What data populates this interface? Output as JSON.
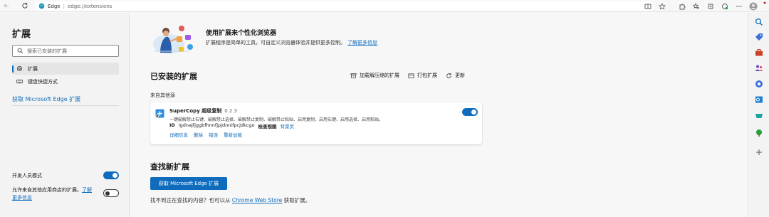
{
  "browser": {
    "edge_chip": "Edge",
    "address_sep": "|",
    "url": "edge://extensions"
  },
  "sidebar": {
    "title": "扩展",
    "search_placeholder": "搜索已安装的扩展",
    "items": [
      {
        "label": "扩展",
        "icon": "gear-icon",
        "active": true
      },
      {
        "label": "键盘快捷方式",
        "icon": "keyboard-icon",
        "active": false
      }
    ],
    "get_link": "获取 Microsoft Edge 扩展",
    "developer_mode": {
      "label": "开发人员模式",
      "on": true
    },
    "allow_other_stores": {
      "text": "允许来自其他应用商店的扩展。",
      "link": "了解更多信息",
      "on": false
    }
  },
  "hero": {
    "title": "使用扩展来个性化浏览器",
    "description": "扩展程序是简单的工具，可自定义浏览器体验并提供更多控制。",
    "link": "了解更多信息"
  },
  "installed": {
    "title": "已安装的扩展",
    "actions": [
      {
        "label": "加载解压缩的扩展",
        "icon": "load-unpacked-icon"
      },
      {
        "label": "打包扩展",
        "icon": "pack-icon"
      },
      {
        "label": "更新",
        "icon": "refresh-icon"
      }
    ],
    "group_label": "来自其他源"
  },
  "extension": {
    "name": "SuperCopy 超级复制",
    "version": "0.2.3",
    "description": "一键破解禁止右键、破解禁止选择、破解禁止复制、破解禁止粘贴、启用复制、启用右键、启用选择、启用粘贴。",
    "id_label": "ID",
    "id_value": "igdnajfjggbfhnnfjpjdnnifpcjdkcgo",
    "inspect_label": "检查视图",
    "background_page": "背景页",
    "links": [
      "详细信息",
      "删除",
      "错误",
      "重新加载"
    ],
    "enabled": true
  },
  "find": {
    "title": "查找新扩展",
    "button": "获取 Microsoft Edge 扩展",
    "text_before": "找不到正在查找的内容？也可以从",
    "store_link": "Chrome Web Store",
    "text_after": "获取扩展。"
  },
  "colors": {
    "accent": "#0f6cbd",
    "background": "#f7f7f7",
    "panel": "#f3f3f3"
  }
}
